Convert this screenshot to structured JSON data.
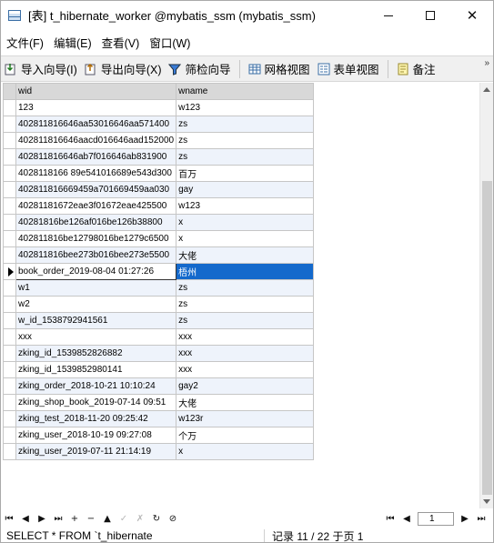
{
  "window": {
    "title": "[表] t_hibernate_worker @mybatis_ssm (mybatis_ssm)",
    "close_glyph": "✕"
  },
  "menu": [
    {
      "label": "文件(F)"
    },
    {
      "label": "编辑(E)"
    },
    {
      "label": "查看(V)"
    },
    {
      "label": "窗口(W)"
    }
  ],
  "toolbar": {
    "import_label": "导入向导(I)",
    "export_label": "导出向导(X)",
    "filter_label": "筛检向导",
    "grid_view_label": "网格视图",
    "form_view_label": "表单视图",
    "memo_label": "备注",
    "more_glyph": "»"
  },
  "grid": {
    "columns": [
      "wid",
      "wname"
    ],
    "rows": [
      [
        "123",
        "w123"
      ],
      [
        "402811816646aa53016646aa571400",
        "zs"
      ],
      [
        "402811816646aacd016646aad152000",
        "zs"
      ],
      [
        "402811816646ab7f016646ab831900",
        "zs"
      ],
      [
        "4028118166 89e541016689e543d300",
        "百万"
      ],
      [
        "402811816669459a701669459aa030",
        "gay"
      ],
      [
        "40281181672eae3f01672eae425500",
        "w123"
      ],
      [
        "40281816be126af016be126b38800",
        "x"
      ],
      [
        "402811816be12798016be1279c6500",
        "x"
      ],
      [
        "402811816bee273b016bee273e5500",
        "大佬"
      ],
      [
        "book_order_2019-08-04 01:27:26",
        "梧州"
      ],
      [
        "w1",
        "zs"
      ],
      [
        "w2",
        "zs"
      ],
      [
        "w_id_1538792941561",
        "zs"
      ],
      [
        "xxx",
        "xxx"
      ],
      [
        "zking_id_1539852826882",
        "xxx"
      ],
      [
        "zking_id_1539852980141",
        "xxx"
      ],
      [
        "zking_order_2018-10-21 10:10:24",
        "gay2"
      ],
      [
        "zking_shop_book_2019-07-14 09:51",
        "大佬"
      ],
      [
        "zking_test_2018-11-20 09:25:42",
        "w123r"
      ],
      [
        "zking_user_2018-10-19 09:27:08",
        "个万"
      ],
      [
        "zking_user_2019-07-11 21:14:19",
        "x"
      ]
    ],
    "current_row": 10
  },
  "navigator": {
    "buttons": [
      "⏮",
      "◀",
      "▶",
      "⏭",
      "+",
      "−",
      "▲",
      "✓",
      "✗",
      "↻",
      "⊘"
    ],
    "page_value": "1",
    "first_glyph": "⏮",
    "prev_glyph": "◀",
    "next_glyph": "▶",
    "last_glyph": "⏭"
  },
  "status": {
    "sql": "SELECT * FROM `t_hibernate",
    "record": "记录 11 / 22 于页 1"
  },
  "colors": {
    "selection": "#1469cc",
    "alt_row": "#eef3fb",
    "header": "#d8d8d8"
  }
}
